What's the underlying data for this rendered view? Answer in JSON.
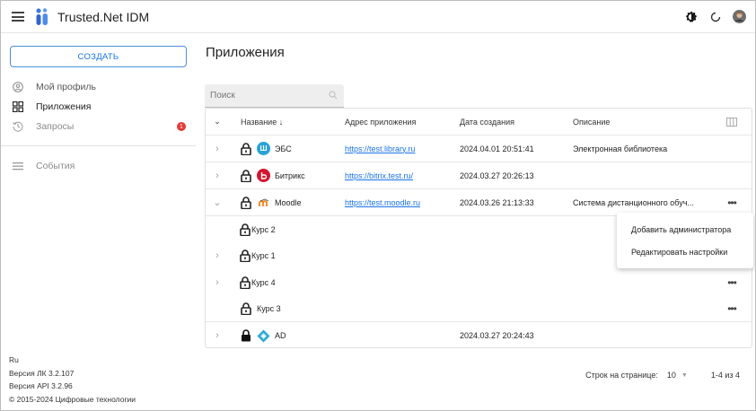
{
  "app": {
    "title": "Trusted.Net IDM"
  },
  "sidebar": {
    "create_label": "СОЗДАТЬ",
    "items": [
      {
        "label": "Мой профиль",
        "icon": "profile-icon"
      },
      {
        "label": "Приложения",
        "icon": "apps-grid-icon"
      },
      {
        "label": "Запросы",
        "icon": "history-icon",
        "badge": "1"
      },
      {
        "label": "События",
        "icon": "list-icon"
      }
    ],
    "footer": {
      "lang": "Ru",
      "lk_version": "Версия ЛК 3.2.107",
      "api_version": "Версия API 3.2.96",
      "copyright": "© 2015-2024 Цифровые технологии"
    }
  },
  "main": {
    "title": "Приложения",
    "search_placeholder": "Поиск",
    "columns": {
      "name": "Название ↓",
      "url": "Адрес приложения",
      "date": "Дата создания",
      "desc": "Описание"
    },
    "rows": [
      {
        "name": "ЭБС",
        "url": "https://test.library.ru",
        "date": "2024.04.01 20:51:41",
        "desc": "Электронная библиотека",
        "icon": "library-app-icon"
      },
      {
        "name": "Битрикс",
        "url": "https://bitrix.test.ru/",
        "date": "2024.03.27 20:26:13",
        "desc": "",
        "icon": "bitrix-app-icon"
      },
      {
        "name": "Moodle",
        "url": "https://test.moodle.ru",
        "date": "2024.03.26 21:13:33",
        "desc": "Система дистанционного обуч...",
        "icon": "moodle-app-icon"
      }
    ],
    "subrows": [
      {
        "name": "Курс 2"
      },
      {
        "name": "Курс 1"
      },
      {
        "name": "Курс 4"
      },
      {
        "name": "Курс 3"
      }
    ],
    "last_row": {
      "name": "AD",
      "url": "",
      "date": "2024.03.27 20:24:43",
      "desc": "",
      "icon": "ad-app-icon"
    },
    "context_menu": [
      "Добавить администратора",
      "Редактировать настройки"
    ],
    "pager": {
      "rows_label": "Строк на странице:",
      "per_page": "10",
      "range": "1-4 из 4"
    }
  },
  "colors": {
    "accent": "#1a73e8",
    "badge": "#e53935",
    "moodle": "#f98012",
    "ad": "#2aa4d8",
    "library": "#29a3d6",
    "bitrix": "#d2162d"
  }
}
